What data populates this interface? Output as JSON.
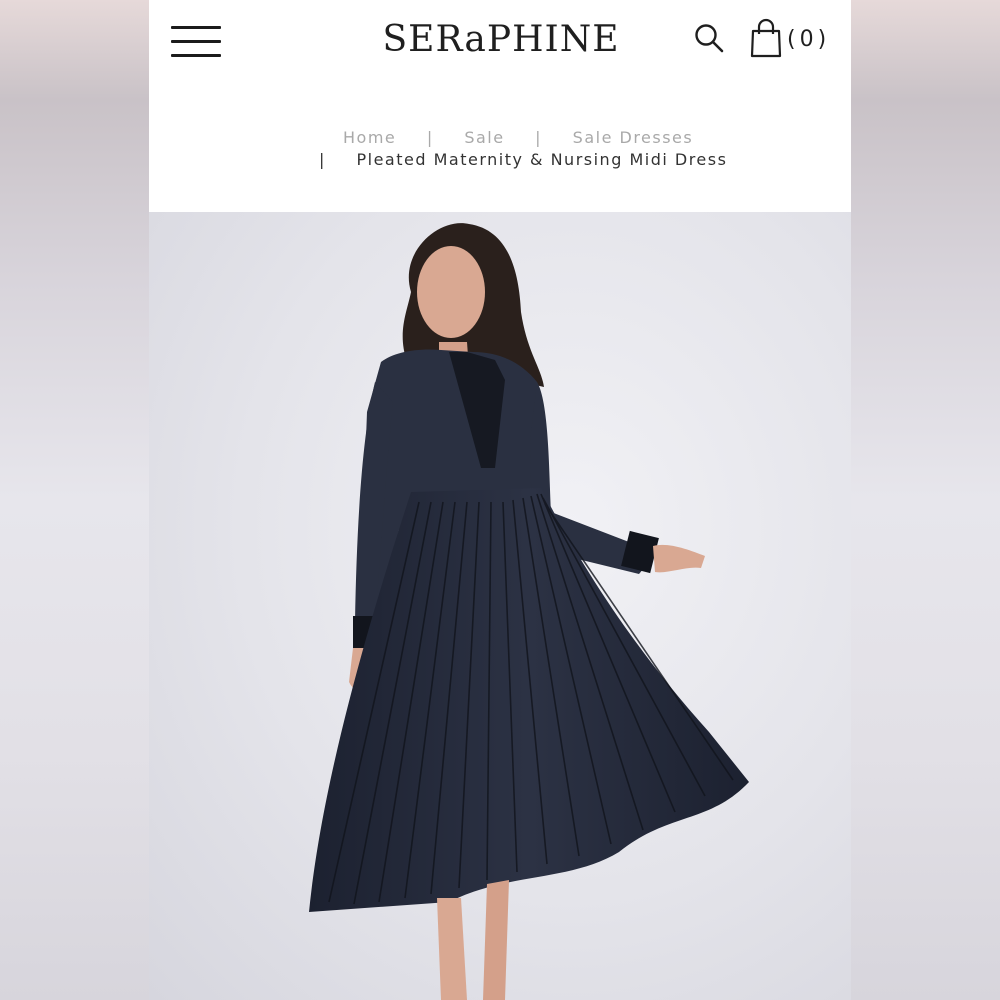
{
  "header": {
    "logo_text": "SERaPHINE",
    "bag_count": "(0)",
    "icons": [
      "hamburger-menu-icon",
      "search-icon",
      "shopping-bag-icon"
    ]
  },
  "breadcrumb": {
    "items": [
      "Home",
      "Sale",
      "Sale Dresses"
    ],
    "separator": "|",
    "current": "Pleated Maternity & Nursing Midi Dress"
  },
  "colors": {
    "page_bg": "#ffffff",
    "text_dark": "#1f1f1f",
    "breadcrumb_muted": "#a9a9a9",
    "dress_navy": "#252a38",
    "image_bg": "#e6e6ec"
  }
}
